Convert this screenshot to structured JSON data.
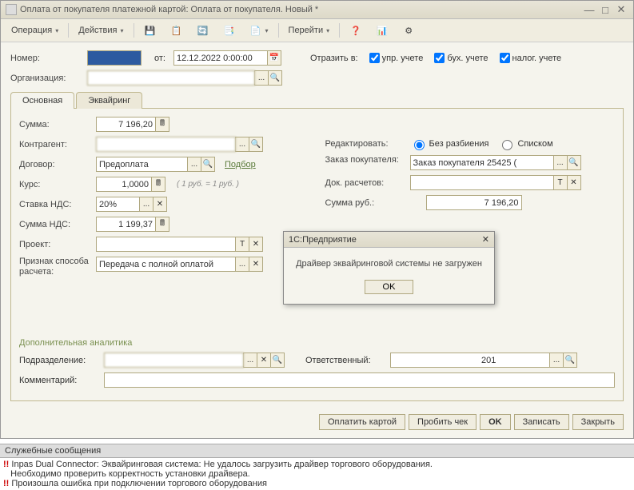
{
  "title": "Оплата от покупателя платежной картой: Оплата от покупателя. Новый *",
  "toolbar": {
    "operation": "Операция",
    "actions": "Действия",
    "goto": "Перейти"
  },
  "header": {
    "number_label": "Номер:",
    "number_value": "",
    "from_label": "от:",
    "date": "12.12.2022 0:00:00",
    "reflect_label": "Отразить в:",
    "chk_mgmt": "упр. учете",
    "chk_acc": "бух. учете",
    "chk_tax": "налог. учете",
    "org_label": "Организация:",
    "org_value": ""
  },
  "tabs": {
    "main": "Основная",
    "acq": "Эквайринг"
  },
  "left": {
    "sum_label": "Сумма:",
    "sum_value": "7 196,20",
    "contragent_label": "Контрагент:",
    "contragent_value": "",
    "contract_label": "Договор:",
    "contract_value": "Предоплата",
    "podbor": "Подбор",
    "rate_label": "Курс:",
    "rate_value": "1,0000",
    "rate_note": "( 1 руб. = 1 руб. )",
    "vat_rate_label": "Ставка НДС:",
    "vat_rate_value": "20%",
    "vat_sum_label": "Сумма НДС:",
    "vat_sum_value": "1 199,37",
    "project_label": "Проект:",
    "project_value": "",
    "sign_label": "Признак способа расчета:",
    "sign_value": "Передача с полной оплатой"
  },
  "right": {
    "edit_label": "Редактировать:",
    "radio_no_split": "Без разбиения",
    "radio_list": "Списком",
    "order_label": "Заказ покупателя:",
    "order_value": "Заказ покупателя             25425 (",
    "doc_label": "Док. расчетов:",
    "doc_value": "",
    "sum_rub_label": "Сумма руб.:",
    "sum_rub_value": "7 196,20"
  },
  "dialog": {
    "title": "1С:Предприятие",
    "text": "Драйвер эквайринговой системы не загружен",
    "ok": "OK"
  },
  "analytics": {
    "title": "Дополнительная аналитика",
    "dept_label": "Подразделение:",
    "dept_value": "",
    "resp_label": "Ответственный:",
    "resp_value": "                                    201",
    "comment_label": "Комментарий:",
    "comment_value": ""
  },
  "buttons": {
    "pay_card": "Оплатить картой",
    "receipt": "Пробить чек",
    "ok": "OK",
    "save": "Записать",
    "close": "Закрыть"
  },
  "messages": {
    "header": "Служебные сообщения",
    "line1": "Inpas Dual Connector: Эквайринговая система: Не удалось загрузить драйвер торгового оборудования.",
    "line2": "Необходимо проверить корректность установки драйвера.",
    "line3": "Произошла ошибка при подключении торгового оборудования"
  }
}
